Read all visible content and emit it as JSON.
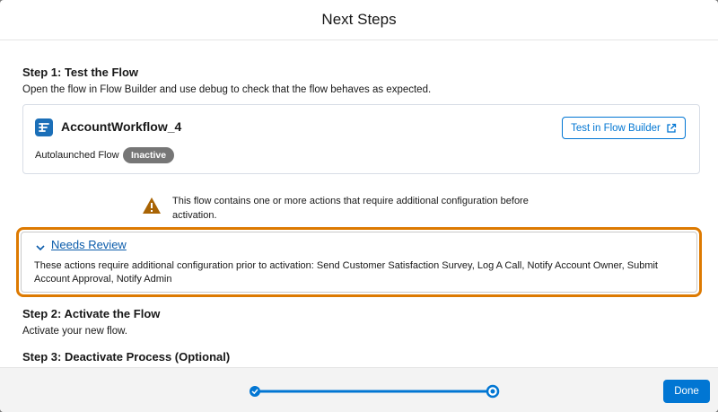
{
  "modal": {
    "title": "Next Steps"
  },
  "step1": {
    "heading": "Step 1: Test the Flow",
    "description": "Open the flow in Flow Builder and use debug to check that the flow behaves as expected.",
    "flow": {
      "icon": "flow-icon",
      "name": "AccountWorkflow_4",
      "type": "Autolaunched Flow",
      "status": "Inactive"
    },
    "test_button": {
      "label": "Test in Flow Builder",
      "icon": "external-link-icon"
    }
  },
  "warning": {
    "icon": "warning-icon",
    "text": "This flow contains one or more actions that require additional configuration before activation."
  },
  "review": {
    "title": "Needs Review",
    "icon": "chevron-down-icon",
    "text": "These actions require additional configuration prior to activation: Send Customer Satisfaction Survey, Log A Call, Notify Account Owner, Submit Account Approval, Notify Admin"
  },
  "step2": {
    "heading": "Step 2: Activate the Flow",
    "description": "Activate your new flow."
  },
  "step3": {
    "heading": "Step 3: Deactivate Process (Optional)"
  },
  "footer": {
    "progress": {
      "total_steps": 2,
      "current_step": 2
    },
    "done_label": "Done"
  },
  "colors": {
    "accent": "#0176d3",
    "highlight": "#dd7a01",
    "warning": "#a96404",
    "badge": "#767676"
  }
}
